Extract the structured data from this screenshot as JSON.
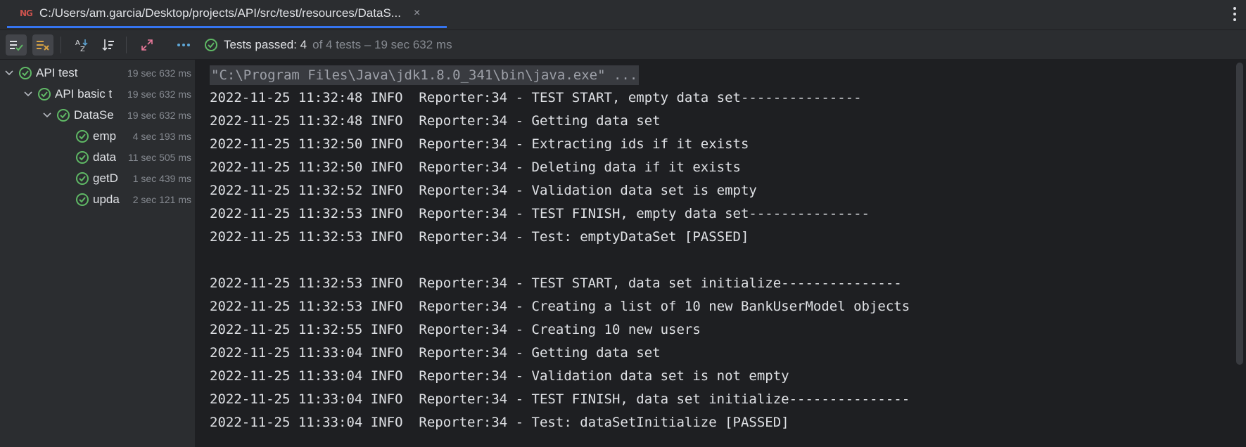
{
  "tab": {
    "logo": "NG",
    "title": "C:/Users/am.garcia/Desktop/projects/API/src/test/resources/DataS...",
    "close": "×"
  },
  "toolbar": {
    "status_passed": "Tests passed: 4",
    "status_rest": "of 4 tests – 19 sec 632 ms"
  },
  "tree": [
    {
      "label": "API test",
      "time": "19 sec 632 ms",
      "level": 0,
      "expanded": true
    },
    {
      "label": "API basic t",
      "time": "19 sec 632 ms",
      "level": 1,
      "expanded": true
    },
    {
      "label": "DataSe",
      "time": "19 sec 632 ms",
      "level": 2,
      "expanded": true
    },
    {
      "label": "emp",
      "time": "4 sec 193 ms",
      "level": 3
    },
    {
      "label": "data",
      "time": "11 sec 505 ms",
      "level": 3
    },
    {
      "label": "getD",
      "time": "1 sec 439 ms",
      "level": 3
    },
    {
      "label": "upda",
      "time": "2 sec 121 ms",
      "level": 3
    }
  ],
  "console": {
    "command": "\"C:\\Program Files\\Java\\jdk1.8.0_341\\bin\\java.exe\" ...",
    "lines": [
      "2022-11-25 11:32:48 INFO  Reporter:34 - TEST START, empty data set---------------",
      "2022-11-25 11:32:48 INFO  Reporter:34 - Getting data set",
      "2022-11-25 11:32:50 INFO  Reporter:34 - Extracting ids if it exists",
      "2022-11-25 11:32:50 INFO  Reporter:34 - Deleting data if it exists",
      "2022-11-25 11:32:52 INFO  Reporter:34 - Validation data set is empty",
      "2022-11-25 11:32:53 INFO  Reporter:34 - TEST FINISH, empty data set---------------",
      "2022-11-25 11:32:53 INFO  Reporter:34 - Test: emptyDataSet [PASSED]",
      "",
      "2022-11-25 11:32:53 INFO  Reporter:34 - TEST START, data set initialize---------------",
      "2022-11-25 11:32:53 INFO  Reporter:34 - Creating a list of 10 new BankUserModel objects",
      "2022-11-25 11:32:55 INFO  Reporter:34 - Creating 10 new users",
      "2022-11-25 11:33:04 INFO  Reporter:34 - Getting data set",
      "2022-11-25 11:33:04 INFO  Reporter:34 - Validation data set is not empty",
      "2022-11-25 11:33:04 INFO  Reporter:34 - TEST FINISH, data set initialize---------------",
      "2022-11-25 11:33:04 INFO  Reporter:34 - Test: dataSetInitialize [PASSED]"
    ]
  },
  "colors": {
    "accent": "#3574f0",
    "pass_green": "#5fb865",
    "yellow": "#d9a343"
  }
}
